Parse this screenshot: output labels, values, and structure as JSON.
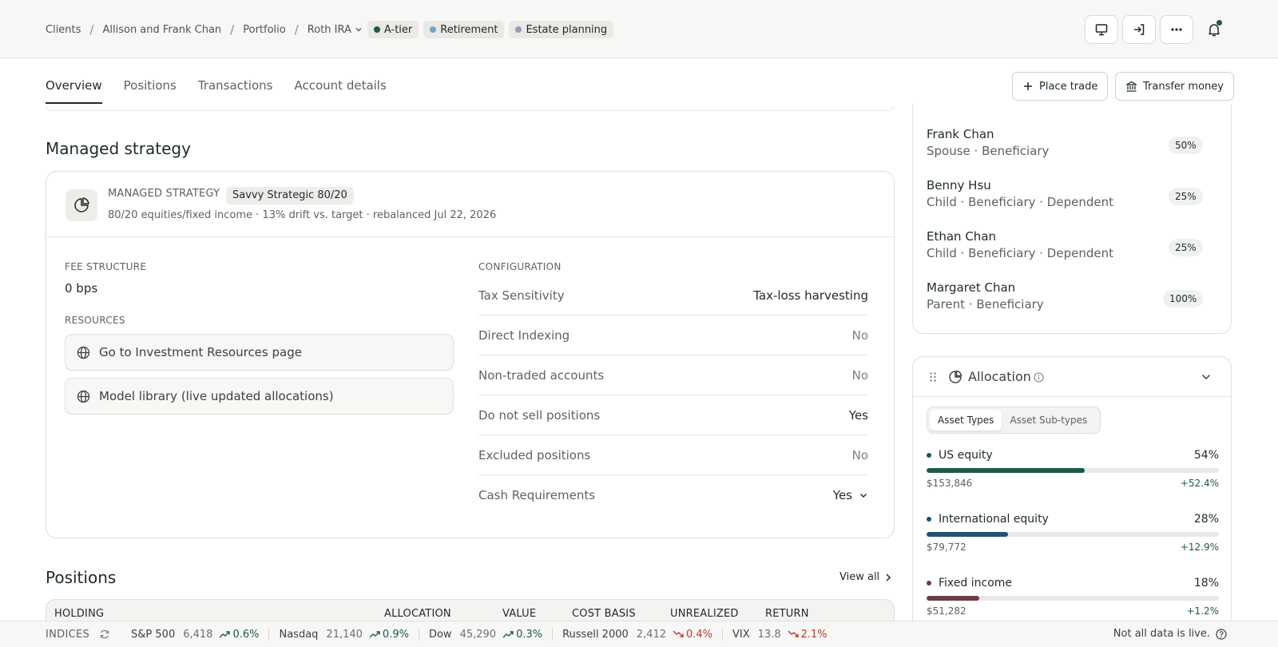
{
  "breadcrumb": {
    "items": [
      "Clients",
      "Allison and Frank Chan",
      "Portfolio"
    ],
    "account": "Roth IRA",
    "tags": [
      {
        "label": "A-tier",
        "color": "#1e5a44"
      },
      {
        "label": "Retirement",
        "color": "#6fa8c4"
      },
      {
        "label": "Estate planning",
        "color": "#a894b0"
      }
    ]
  },
  "tabs": [
    "Overview",
    "Positions",
    "Transactions",
    "Account details"
  ],
  "actions": {
    "place_trade": "Place trade",
    "transfer_money": "Transfer money"
  },
  "managed_strategy": {
    "section_title": "Managed strategy",
    "label": "MANAGED STRATEGY",
    "name": "Savvy Strategic 80/20",
    "subtitle": "80/20 equities/fixed income · 13% drift vs. target · rebalanced Jul 22, 2026",
    "fee_caption": "FEE STRUCTURE",
    "fee_value": "0 bps",
    "resources_caption": "RESOURCES",
    "resources": [
      "Go to Investment Resources page",
      "Model library (live updated allocations)"
    ],
    "config_caption": "CONFIGURATION",
    "config": [
      {
        "key": "Tax Sensitivity",
        "value": "Tax-loss harvesting"
      },
      {
        "key": "Direct Indexing",
        "value": "No"
      },
      {
        "key": "Non-traded accounts",
        "value": "No"
      },
      {
        "key": "Do not sell positions",
        "value": "Yes"
      },
      {
        "key": "Excluded positions",
        "value": "No"
      },
      {
        "key": "Cash Requirements",
        "value": "Yes"
      }
    ]
  },
  "positions": {
    "section_title": "Positions",
    "view_all": "View all",
    "columns": [
      "HOLDING",
      "ALLOCATION",
      "VALUE",
      "COST BASIS",
      "UNREALIZED",
      "RETURN"
    ]
  },
  "beneficiaries": [
    {
      "name": "Frank Chan",
      "relation": "Spouse · Beneficiary",
      "pct": "50%"
    },
    {
      "name": "Benny Hsu",
      "relation": "Child · Beneficiary · Dependent",
      "pct": "25%"
    },
    {
      "name": "Ethan Chan",
      "relation": "Child · Beneficiary · Dependent",
      "pct": "25%"
    },
    {
      "name": "Margaret Chan",
      "relation": "Parent · Beneficiary",
      "pct": "100%"
    }
  ],
  "allocation": {
    "title": "Allocation",
    "segments": [
      "Asset Types",
      "Asset Sub-types"
    ],
    "rows": [
      {
        "label": "US equity",
        "pct": "54%",
        "amount": "$153,846",
        "change": "+52.4%",
        "fraction": 0.54,
        "color": "#1e5a44"
      },
      {
        "label": "International equity",
        "pct": "28%",
        "amount": "$79,772",
        "change": "+12.9%",
        "fraction": 0.28,
        "color": "#25506e"
      },
      {
        "label": "Fixed income",
        "pct": "18%",
        "amount": "$51,282",
        "change": "+1.2%",
        "fraction": 0.18,
        "color": "#6a3d44"
      }
    ]
  },
  "ticker": {
    "label": "INDICES",
    "items": [
      {
        "name": "S&P 500",
        "value": "6,418",
        "change": "0.6%",
        "dir": "up"
      },
      {
        "name": "Nasdaq",
        "value": "21,140",
        "change": "0.9%",
        "dir": "up"
      },
      {
        "name": "Dow",
        "value": "45,290",
        "change": "0.3%",
        "dir": "up"
      },
      {
        "name": "Russell 2000",
        "value": "2,412",
        "change": "0.4%",
        "dir": "down"
      },
      {
        "name": "VIX",
        "value": "13.8",
        "change": "2.1%",
        "dir": "down"
      }
    ],
    "live_note": "Not all data is live."
  }
}
